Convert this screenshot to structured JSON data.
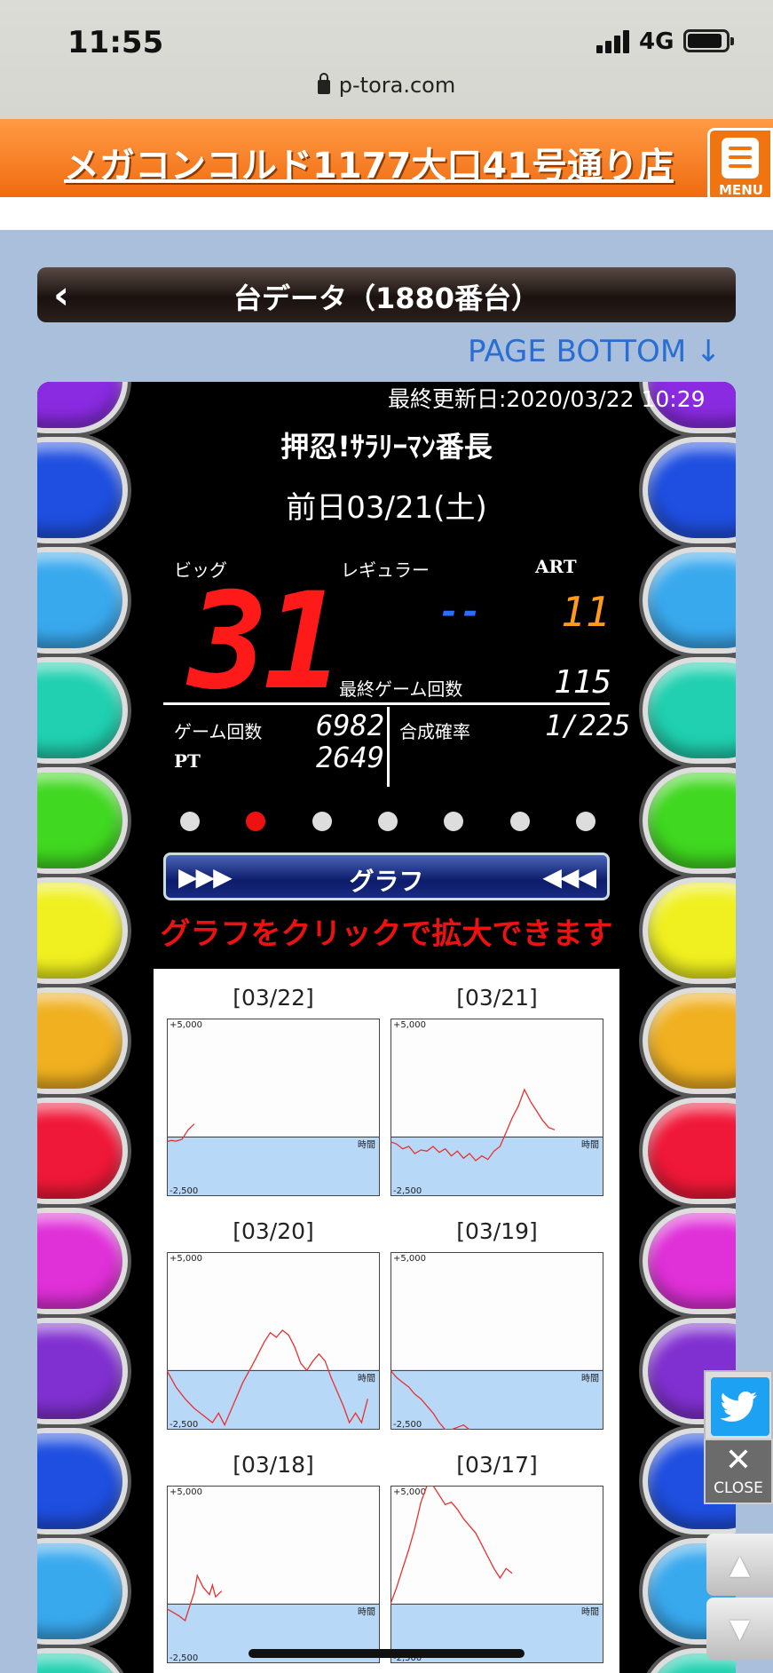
{
  "status": {
    "time": "11:55",
    "network": "4G",
    "url": "p-tora.com"
  },
  "header": {
    "shop_name": "メガコンコルド1177大口41号通り店",
    "menu_label": "MENU"
  },
  "title": {
    "back_icon": "chevron-left-icon",
    "text": "台データ（1880番台）"
  },
  "page_bottom": "PAGE BOTTOM ↓",
  "panel": {
    "updated": "最終更新日:2020/03/22 10:29",
    "machine": "押忍!ｻﾗﾘｰﾏﾝ番長",
    "date": "前日03/21(土)",
    "labels": {
      "big": "ビッグ",
      "regular": "レギュラー",
      "art": "ART",
      "last_games": "最終ゲーム回数",
      "games": "ゲーム回数",
      "pt": "PT",
      "prob": "合成確率"
    },
    "values": {
      "big": "31",
      "regular": "--",
      "art": "11",
      "last_games": "115",
      "games": "6982",
      "pt": "2649",
      "prob": "1/225"
    },
    "colors": {
      "big": "#ff1a1a",
      "regular": "#2a6dff",
      "art": "#ff9a1a",
      "stat": "#ffffff"
    },
    "carousel": {
      "count": 7,
      "active_index": 1
    },
    "graph_bar": {
      "label": "グラフ",
      "left_arrows": "▶▶▶",
      "right_arrows": "◀◀◀"
    },
    "click_message": "グラフをクリックで拡大できます"
  },
  "graphs": {
    "axis": {
      "top": "+5,000",
      "bottom": "-2,500",
      "time": "時間"
    },
    "items": [
      {
        "date": "[03/22]",
        "trace": [
          [
            0,
            -200
          ],
          [
            3,
            -150
          ],
          [
            6,
            -180
          ],
          [
            10,
            -100
          ],
          [
            14,
            300
          ],
          [
            18,
            550
          ]
        ]
      },
      {
        "date": "[03/21]",
        "trace": [
          [
            0,
            -200
          ],
          [
            4,
            -300
          ],
          [
            8,
            -500
          ],
          [
            12,
            -400
          ],
          [
            16,
            -700
          ],
          [
            20,
            -550
          ],
          [
            24,
            -600
          ],
          [
            28,
            -400
          ],
          [
            32,
            -650
          ],
          [
            36,
            -500
          ],
          [
            40,
            -800
          ],
          [
            44,
            -600
          ],
          [
            48,
            -900
          ],
          [
            52,
            -700
          ],
          [
            56,
            -1000
          ],
          [
            60,
            -800
          ],
          [
            64,
            -950
          ],
          [
            68,
            -600
          ],
          [
            72,
            -400
          ],
          [
            76,
            200
          ],
          [
            80,
            800
          ],
          [
            84,
            1300
          ],
          [
            88,
            2000
          ],
          [
            92,
            1500
          ],
          [
            96,
            1100
          ],
          [
            100,
            700
          ],
          [
            104,
            400
          ],
          [
            108,
            300
          ]
        ]
      },
      {
        "date": "[03/20]",
        "trace": [
          [
            0,
            0
          ],
          [
            6,
            -700
          ],
          [
            12,
            -1200
          ],
          [
            18,
            -1600
          ],
          [
            24,
            -1900
          ],
          [
            30,
            -2200
          ],
          [
            34,
            -1800
          ],
          [
            38,
            -2300
          ],
          [
            44,
            -1400
          ],
          [
            50,
            -500
          ],
          [
            56,
            200
          ],
          [
            60,
            700
          ],
          [
            64,
            1200
          ],
          [
            68,
            1600
          ],
          [
            72,
            1400
          ],
          [
            76,
            1700
          ],
          [
            80,
            1500
          ],
          [
            84,
            1000
          ],
          [
            88,
            300
          ],
          [
            92,
            0
          ],
          [
            96,
            400
          ],
          [
            100,
            700
          ],
          [
            104,
            400
          ],
          [
            108,
            -300
          ],
          [
            112,
            -900
          ],
          [
            116,
            -1500
          ],
          [
            120,
            -2200
          ],
          [
            124,
            -1800
          ],
          [
            128,
            -2200
          ],
          [
            132,
            -1200
          ]
        ]
      },
      {
        "date": "[03/19]",
        "trace": [
          [
            0,
            0
          ],
          [
            4,
            -300
          ],
          [
            8,
            -500
          ],
          [
            12,
            -700
          ],
          [
            16,
            -1000
          ],
          [
            20,
            -1200
          ],
          [
            24,
            -1500
          ],
          [
            28,
            -1800
          ],
          [
            32,
            -2200
          ],
          [
            36,
            -2500
          ],
          [
            40,
            -2500
          ],
          [
            44,
            -2400
          ],
          [
            48,
            -2300
          ],
          [
            52,
            -2500
          ]
        ]
      },
      {
        "date": "[03/18]",
        "trace": [
          [
            0,
            -200
          ],
          [
            4,
            -350
          ],
          [
            8,
            -500
          ],
          [
            12,
            -700
          ],
          [
            14,
            -300
          ],
          [
            18,
            500
          ],
          [
            20,
            1200
          ],
          [
            24,
            700
          ],
          [
            28,
            400
          ],
          [
            30,
            800
          ],
          [
            32,
            300
          ],
          [
            36,
            550
          ]
        ]
      },
      {
        "date": "[03/17]",
        "trace": [
          [
            0,
            0
          ],
          [
            4,
            700
          ],
          [
            8,
            1500
          ],
          [
            12,
            2300
          ],
          [
            16,
            3200
          ],
          [
            20,
            4300
          ],
          [
            24,
            5000
          ],
          [
            28,
            5000
          ],
          [
            32,
            4600
          ],
          [
            36,
            4200
          ],
          [
            40,
            4300
          ],
          [
            44,
            4000
          ],
          [
            48,
            3600
          ],
          [
            52,
            3300
          ],
          [
            56,
            3000
          ],
          [
            60,
            2500
          ],
          [
            64,
            2000
          ],
          [
            68,
            1500
          ],
          [
            72,
            1100
          ],
          [
            76,
            1500
          ],
          [
            80,
            1300
          ]
        ]
      }
    ]
  },
  "floating": {
    "twitter_icon": "twitter-icon",
    "close_label": "CLOSE",
    "up_label": "▲",
    "down_label": "▼"
  }
}
